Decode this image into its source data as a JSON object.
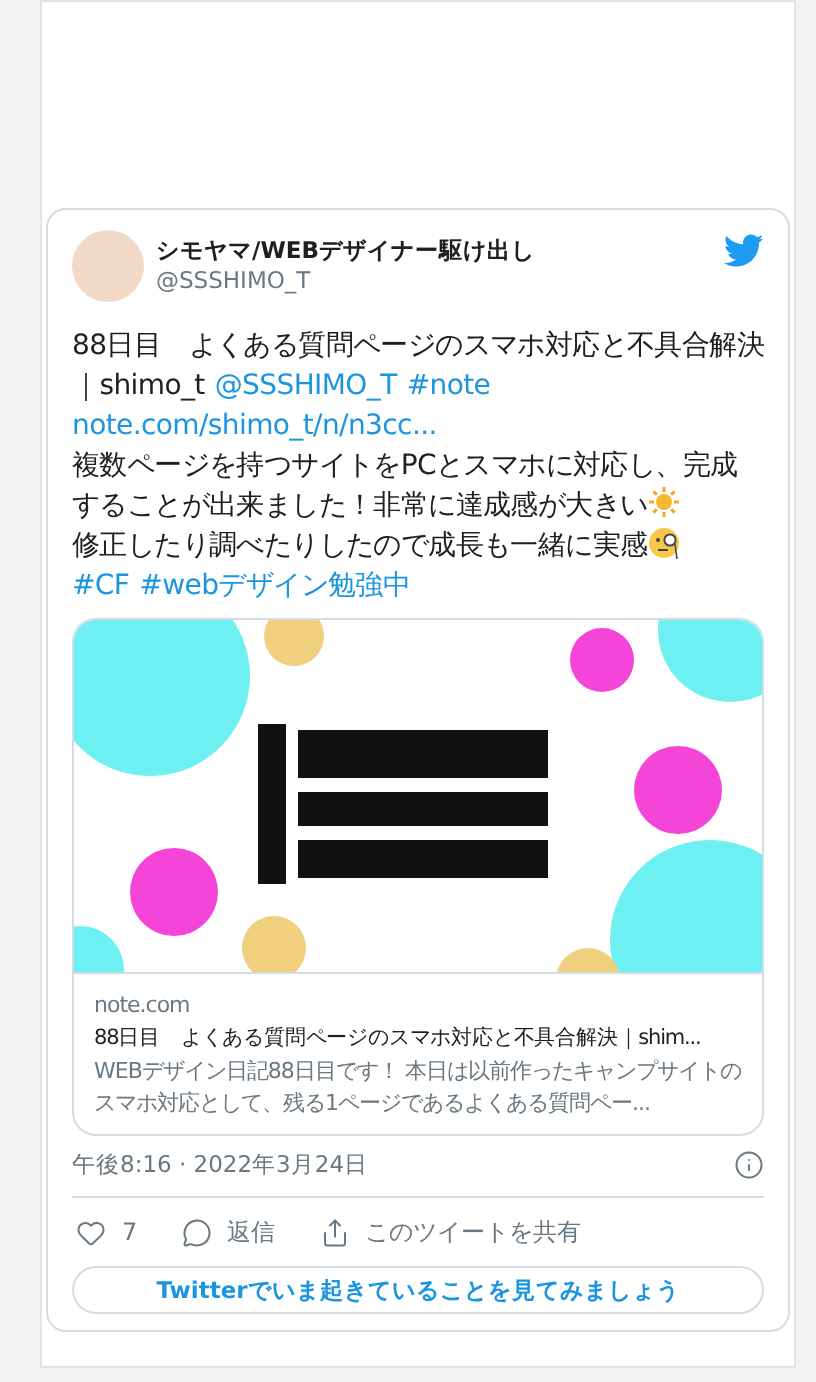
{
  "author": {
    "name": "シモヤマ/WEBデザイナー駆け出し",
    "handle": "@SSSHIMO_T"
  },
  "body": [
    [
      {
        "kind": "text",
        "text": "88日目　よくある質問ページのスマホ対応と不具合解決｜shimo_t"
      },
      {
        "kind": "link",
        "text": "@SSSHIMO_T"
      },
      {
        "kind": "link",
        "text": "#note"
      }
    ],
    [
      {
        "kind": "link",
        "text": "note.com/shimo_t/n/n3cc..."
      }
    ],
    [
      {
        "kind": "text",
        "text": "複数ページを持つサイトをPCとスマホに対応し、完成することが出来ました！非常に達成感が大きい"
      },
      {
        "kind": "sun"
      }
    ],
    [
      {
        "kind": "text",
        "text": "修正したり調べたりしたので成長も一緒に実感"
      },
      {
        "kind": "monocle"
      }
    ],
    [
      {
        "kind": "link",
        "text": "#CF"
      },
      {
        "kind": "link",
        "text": "#webデザイン勉強中"
      }
    ]
  ],
  "link_card": {
    "domain": "note.com",
    "title": "88日目　よくある質問ページのスマホ対応と不具合解決｜shim...",
    "description": "WEBデザイン日記88日目です！ 本日は以前作ったキャンプサイトのスマホ対応として、残る1ページであるよくある質問ペー..."
  },
  "timestamp": "午後8:16 · 2022年3月24日",
  "actions": [
    {
      "kind": "like",
      "label": "7"
    },
    {
      "kind": "reply",
      "label": "返信"
    },
    {
      "kind": "share",
      "label": "このツイートを共有"
    }
  ],
  "cta": "Twitterでいま起きていることを見てみましょう"
}
